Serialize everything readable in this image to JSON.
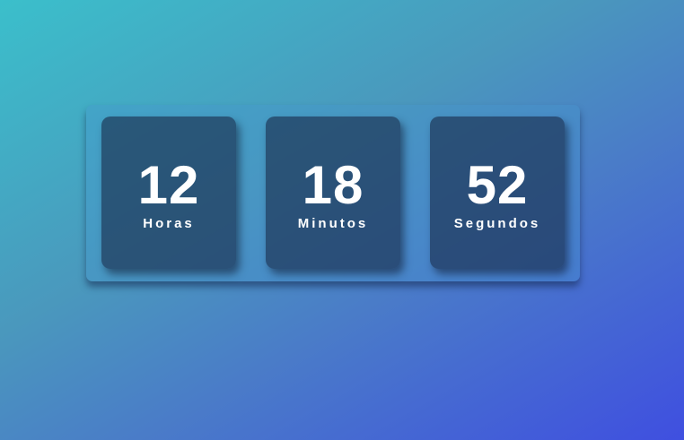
{
  "clock": {
    "hours": {
      "value": "12",
      "label": "Horas"
    },
    "minutes": {
      "value": "18",
      "label": "Minutos"
    },
    "seconds": {
      "value": "52",
      "label": "Segundos"
    }
  },
  "colors": {
    "gradient_start": "#3bbfcb",
    "gradient_end": "#3f4fe0",
    "tile": "#1f3a55",
    "text": "#ffffff"
  }
}
